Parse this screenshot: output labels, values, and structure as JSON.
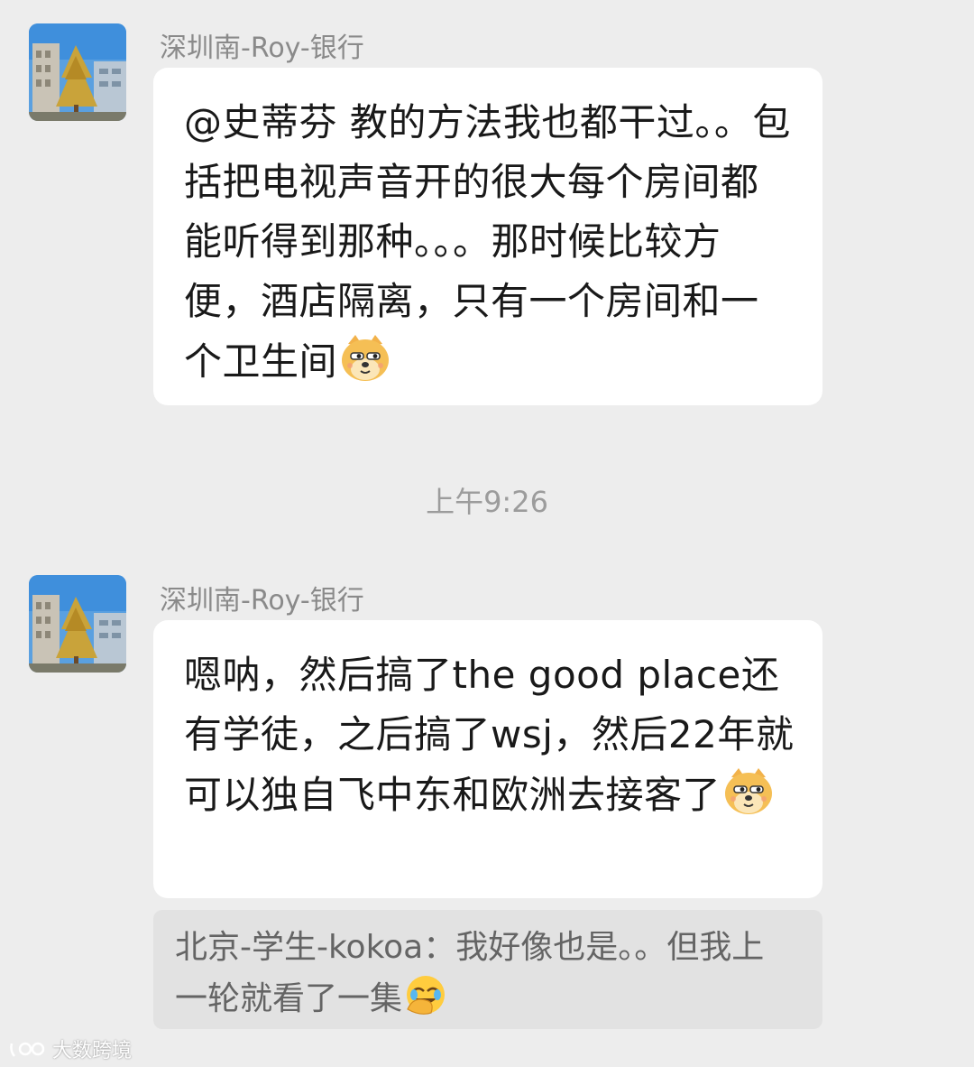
{
  "messages": [
    {
      "sender": "深圳南-Roy-银行",
      "avatar_icon": "building-tree-photo-avatar",
      "text": "@史蒂芬  教的方法我也都干过。。包括把电视声音开的很大每个房间都能听得到那种。。。那时候比较方便，酒店隔离，只有一个房间和一个卫生间",
      "emoji": "doge-emoji"
    },
    {
      "sender": "深圳南-Roy-银行",
      "avatar_icon": "building-tree-photo-avatar",
      "text": "嗯呐，然后搞了the good place还有学徒，之后搞了wsj，然后22年就可以独自飞中东和欧洲去接客了",
      "emoji": "doge-emoji"
    }
  ],
  "timestamp": "上午9:26",
  "quote": {
    "text": "北京-学生-kokoa：我好像也是。。但我上一轮就看了一集",
    "emoji": "facepalm-laugh-emoji"
  },
  "watermark": {
    "text": "大数跨境",
    "icon": "brand-logo-icon"
  },
  "colors": {
    "background": "#ededed",
    "bubble": "#ffffff",
    "quote_bg": "#e2e2e2",
    "sender": "#8a8a8a",
    "timestamp": "#9c9c9c"
  }
}
